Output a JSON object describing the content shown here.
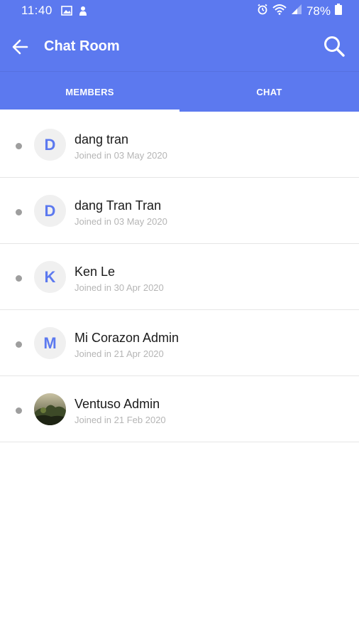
{
  "status_bar": {
    "time": "11:40",
    "battery": "78%",
    "icons": [
      "image-icon",
      "notification-icon",
      "alarm-icon",
      "wifi-icon",
      "signal-icon",
      "battery-icon"
    ]
  },
  "app_bar": {
    "title": "Chat Room",
    "back_icon": "arrow-left-icon",
    "search_icon": "search-icon"
  },
  "tabs": [
    {
      "label": "MEMBERS",
      "active": true
    },
    {
      "label": "CHAT",
      "active": false
    }
  ],
  "members": [
    {
      "name": "dang tran",
      "joined": "Joined in 03 May 2020",
      "initial": "D"
    },
    {
      "name": "dang Tran Tran",
      "joined": "Joined in 03 May 2020",
      "initial": "D"
    },
    {
      "name": "Ken Le",
      "joined": "Joined in 30 Apr 2020",
      "initial": "K"
    },
    {
      "name": "Mi Corazon Admin",
      "joined": "Joined in 21 Apr 2020",
      "initial": "M"
    },
    {
      "name": "Ventuso Admin",
      "joined": "Joined in 21 Feb 2020",
      "initial": ""
    }
  ],
  "colors": {
    "primary": "#5c79ef",
    "offline_dot": "#9e9e9e",
    "avatar_bg": "#f0f0f0",
    "subtitle": "#b5b5b5"
  }
}
